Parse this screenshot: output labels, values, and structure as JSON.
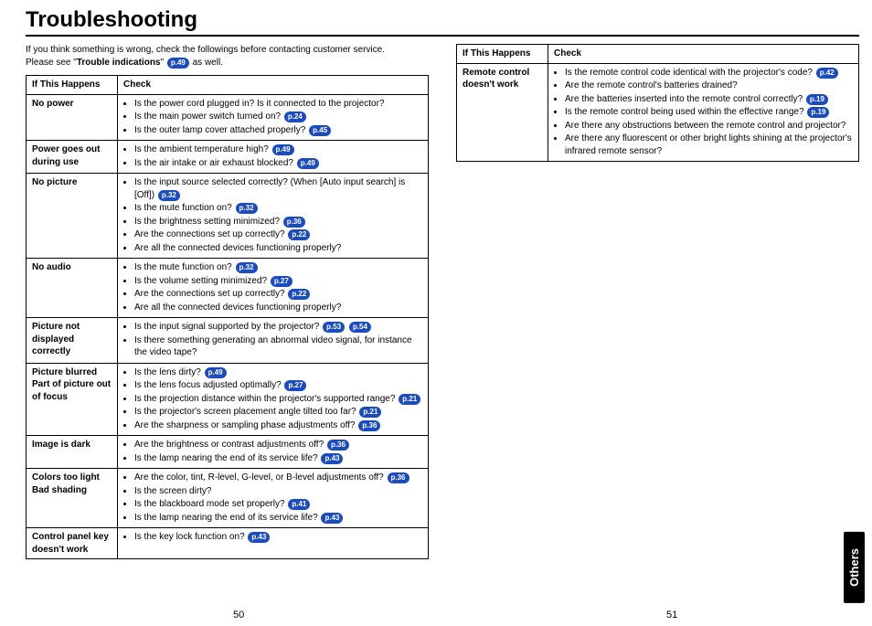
{
  "title": "Troubleshooting",
  "intro_line1": "If you think something is wrong, check the followings before contacting customer service.",
  "intro_prefix": "Please see \"",
  "intro_bold": "Trouble indications",
  "intro_mid": "\" ",
  "intro_ref": "p.49",
  "intro_suffix": " as well.",
  "headers": {
    "col1": "If This Happens",
    "col2": "Check"
  },
  "side_tab": "Others",
  "pagenum_left": "50",
  "pagenum_right": "51",
  "rows_left": [
    {
      "label": "No power",
      "items": [
        {
          "text": "Is the power cord plugged in? Is it connected to the projector?",
          "refs": []
        },
        {
          "text": "Is the main power switch turned on?",
          "refs": [
            "p.24"
          ]
        },
        {
          "text": "Is the outer lamp cover attached properly?",
          "refs": [
            "p.45"
          ]
        }
      ]
    },
    {
      "label": "Power goes out during use",
      "items": [
        {
          "text": "Is the ambient temperature high?",
          "refs": [
            "p.49"
          ]
        },
        {
          "text": "Is the air intake or air exhaust blocked?",
          "refs": [
            "p.49"
          ]
        }
      ]
    },
    {
      "label": "No picture",
      "items": [
        {
          "text": "Is the input source selected correctly? (When [Auto input search] is [Off])",
          "refs": [
            "p.32"
          ]
        },
        {
          "text": "Is the mute function on?",
          "refs": [
            "p.32"
          ]
        },
        {
          "text": "Is the brightness setting minimized?",
          "refs": [
            "p.36"
          ]
        },
        {
          "text": "Are the connections set up correctly?",
          "refs": [
            "p.22"
          ]
        },
        {
          "text": "Are all the connected devices functioning properly?",
          "refs": []
        }
      ]
    },
    {
      "label": "No audio",
      "items": [
        {
          "text": "Is the mute function on?",
          "refs": [
            "p.32"
          ]
        },
        {
          "text": "Is the volume setting minimized?",
          "refs": [
            "p.27"
          ]
        },
        {
          "text": "Are the connections set up correctly?",
          "refs": [
            "p.22"
          ]
        },
        {
          "text": "Are all the connected devices functioning properly?",
          "refs": []
        }
      ]
    },
    {
      "label": "Picture not displayed correctly",
      "items": [
        {
          "text": "Is the input signal supported by the projector?",
          "refs": [
            "p.53",
            "p.54"
          ]
        },
        {
          "text": "Is there something generating an abnormal video signal, for instance the video tape?",
          "refs": []
        }
      ]
    },
    {
      "label": "Picture blurred Part of picture out of focus",
      "items": [
        {
          "text": "Is the lens dirty?",
          "refs": [
            "p.49"
          ]
        },
        {
          "text": "Is the lens focus adjusted optimally?",
          "refs": [
            "p.27"
          ]
        },
        {
          "text": "Is the projection distance within the projector's supported range?",
          "refs": [
            "p.21"
          ]
        },
        {
          "text": "Is the projector's screen placement angle tilted too far?",
          "refs": [
            "p.21"
          ]
        },
        {
          "text": "Are the sharpness or sampling phase adjustments off?",
          "refs": [
            "p.36"
          ]
        }
      ]
    },
    {
      "label": "Image is dark",
      "items": [
        {
          "text": "Are the brightness or contrast adjustments off?",
          "refs": [
            "p.36"
          ]
        },
        {
          "text": "Is the lamp nearing the end of its service life?",
          "refs": [
            "p.43"
          ]
        }
      ]
    },
    {
      "label": "Colors too light Bad shading",
      "items": [
        {
          "text": "Are the color, tint, R-level, G-level, or B-level adjustments off?",
          "refs": [
            "p.36"
          ]
        },
        {
          "text": "Is the screen dirty?",
          "refs": []
        },
        {
          "text": "Is the blackboard mode set properly?",
          "refs": [
            "p.41"
          ]
        },
        {
          "text": "Is the lamp nearing the end of its service life?",
          "refs": [
            "p.43"
          ]
        }
      ]
    },
    {
      "label": "Control panel key doesn't work",
      "items": [
        {
          "text": "Is the key lock function on?",
          "refs": [
            "p.43"
          ]
        }
      ]
    }
  ],
  "rows_right": [
    {
      "label": "Remote control doesn't work",
      "items": [
        {
          "text": "Is the remote control code identical with the projector's code?",
          "refs": [
            "p.42"
          ]
        },
        {
          "text": "Are the remote control's batteries drained?",
          "refs": []
        },
        {
          "text": "Are the batteries inserted into the remote control correctly?",
          "refs": [
            "p.19"
          ]
        },
        {
          "text": "Is the remote control being used within the effective range?",
          "refs": [
            "p.19"
          ]
        },
        {
          "text": "Are there any obstructions between the remote control and projector?",
          "refs": []
        },
        {
          "text": "Are there any fluorescent or other bright lights shining at the projector's infrared remote sensor?",
          "refs": []
        }
      ]
    }
  ]
}
